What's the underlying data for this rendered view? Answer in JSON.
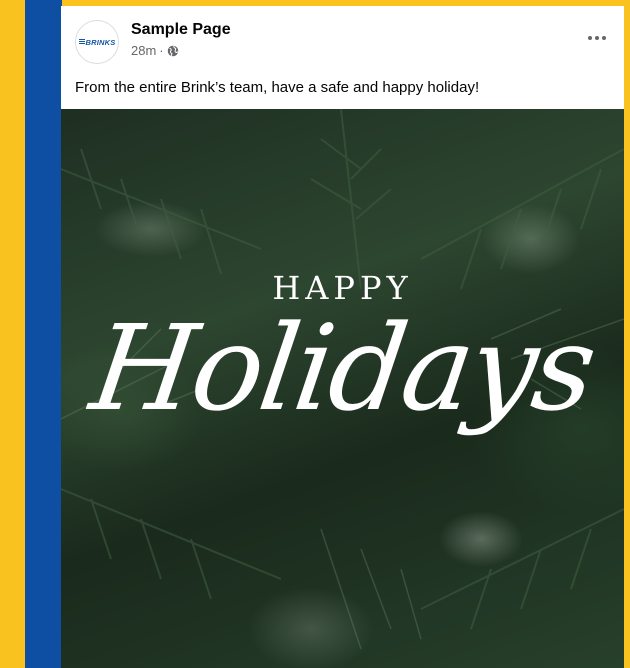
{
  "colors": {
    "frame": "#f9c21f",
    "bar": "#0f4fa3",
    "brand": "#1456a5"
  },
  "post": {
    "page_name": "Sample Page",
    "timestamp": "28m",
    "separator": "·",
    "privacy_icon": "globe-icon",
    "more_icon": "more-options-icon",
    "caption": "From the entire Brink’s team, have a safe and happy holiday!",
    "avatar": {
      "logo_text": "BRINKS"
    },
    "image": {
      "line1": "HAPPY",
      "line2": "Holidays"
    }
  }
}
